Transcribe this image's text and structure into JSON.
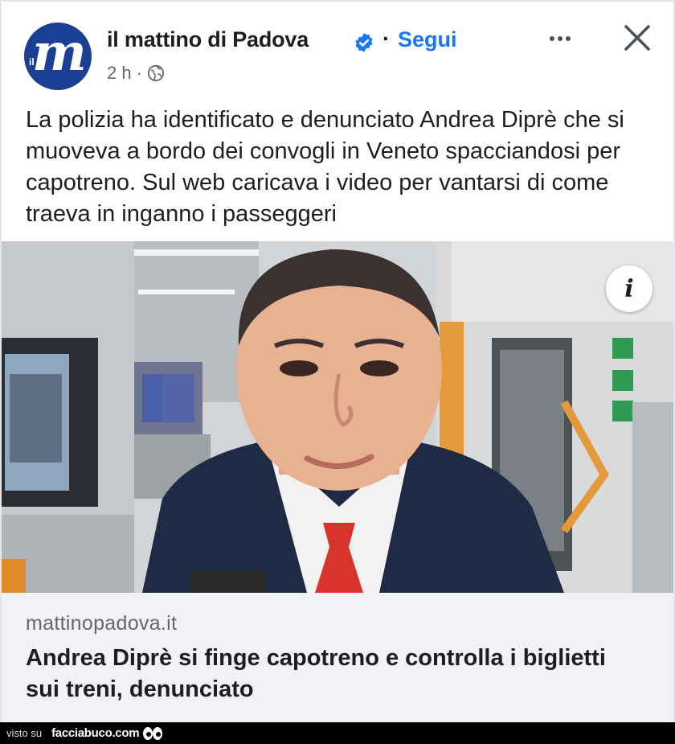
{
  "header": {
    "page_name": "il mattino di Padova",
    "follow_label": "Segui",
    "time": "2 h",
    "meta_sep": "·",
    "avatar_small_text": "il",
    "avatar_letter": "m"
  },
  "post": {
    "text": "La polizia ha identificato e denunciato Andrea Diprè che si muoveva a bordo dei convogli in Veneto spacciandosi per capotreno. Sul web caricava i video per vantarsi di come traeva in inganno i passeggeri"
  },
  "photo": {
    "info_label": "i"
  },
  "link_preview": {
    "domain": "mattinopadova.it",
    "headline": "Andrea Diprè si finge capotreno e controlla i biglietti sui treni, denunciato"
  },
  "watermark": {
    "prefix": "visto su",
    "site": "facciabuco.com"
  },
  "icons": [
    "verified-badge-icon",
    "globe-icon",
    "more-options-icon",
    "close-icon",
    "info-icon",
    "eyes-icon"
  ],
  "colors": {
    "link_blue": "#1877f2",
    "text": "#1c1e21",
    "muted": "#65676b",
    "preview_bg": "#f0f2f5",
    "avatar_bg": "#1a3f94",
    "tie_red": "#d9342b"
  }
}
